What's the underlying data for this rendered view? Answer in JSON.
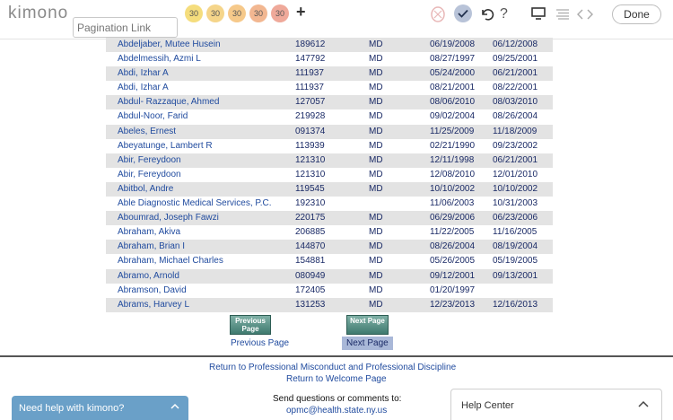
{
  "toolbar": {
    "logo": "kimono",
    "pagination_placeholder": "Pagination Link",
    "badges": [
      "30",
      "30",
      "30",
      "30",
      "30"
    ],
    "add_label": "+",
    "help_label": "?",
    "done_label": "Done"
  },
  "table": {
    "rows": [
      {
        "name": "Abdeljaber, Mutee Husein",
        "num": "189612",
        "deg": "MD",
        "d1": "06/19/2008",
        "d2": "06/12/2008"
      },
      {
        "name": "Abdelmessih, Azmi L",
        "num": "147792",
        "deg": "MD",
        "d1": "08/27/1997",
        "d2": "09/25/2001"
      },
      {
        "name": "Abdi, Izhar A",
        "num": "111937",
        "deg": "MD",
        "d1": "05/24/2000",
        "d2": "06/21/2001"
      },
      {
        "name": "Abdi, Izhar A",
        "num": "111937",
        "deg": "MD",
        "d1": "08/21/2001",
        "d2": "08/22/2001"
      },
      {
        "name": "Abdul- Razzaque, Ahmed",
        "num": "127057",
        "deg": "MD",
        "d1": "08/06/2010",
        "d2": "08/03/2010"
      },
      {
        "name": "Abdul-Noor, Farid",
        "num": "219928",
        "deg": "MD",
        "d1": "09/02/2004",
        "d2": "08/26/2004"
      },
      {
        "name": "Abeles, Ernest",
        "num": "091374",
        "deg": "MD",
        "d1": "11/25/2009",
        "d2": "11/18/2009"
      },
      {
        "name": "Abeyatunge, Lambert R",
        "num": "113939",
        "deg": "MD",
        "d1": "02/21/1990",
        "d2": "09/23/2002"
      },
      {
        "name": "Abir, Fereydoon",
        "num": "121310",
        "deg": "MD",
        "d1": "12/11/1998",
        "d2": "06/21/2001"
      },
      {
        "name": "Abir, Fereydoon",
        "num": "121310",
        "deg": "MD",
        "d1": "12/08/2010",
        "d2": "12/01/2010"
      },
      {
        "name": "Abitbol, Andre",
        "num": "119545",
        "deg": "MD",
        "d1": "10/10/2002",
        "d2": "10/10/2002"
      },
      {
        "name": "Able Diagnostic Medical Services, P.C.",
        "num": "192310",
        "deg": "",
        "d1": "11/06/2003",
        "d2": "10/31/2003"
      },
      {
        "name": "Aboumrad, Joseph Fawzi",
        "num": "220175",
        "deg": "MD",
        "d1": "06/29/2006",
        "d2": "06/23/2006"
      },
      {
        "name": "Abraham, Akiva",
        "num": "206885",
        "deg": "MD",
        "d1": "11/22/2005",
        "d2": "11/16/2005"
      },
      {
        "name": "Abraham, Brian I",
        "num": "144870",
        "deg": "MD",
        "d1": "08/26/2004",
        "d2": "08/19/2004"
      },
      {
        "name": "Abraham, Michael Charles",
        "num": "154881",
        "deg": "MD",
        "d1": "05/26/2005",
        "d2": "05/19/2005"
      },
      {
        "name": "Abramo, Arnold",
        "num": "080949",
        "deg": "MD",
        "d1": "09/12/2001",
        "d2": "09/13/2001"
      },
      {
        "name": "Abramson, David",
        "num": "172405",
        "deg": "MD",
        "d1": "01/20/1997",
        "d2": ""
      },
      {
        "name": "Abrams, Harvey L",
        "num": "131253",
        "deg": "MD",
        "d1": "12/23/2013",
        "d2": "12/16/2013"
      }
    ]
  },
  "pager": {
    "prev_img_text": "Previous Page",
    "next_img_text": "Next Page",
    "prev_link": "Previous Page",
    "next_link": "Next Page"
  },
  "footer": {
    "link1": "Return to Professional Misconduct and Professional Discipline",
    "link2": "Return to Welcome Page",
    "send": "Send questions or comments to:",
    "email": "opmc@health.state.ny.us"
  },
  "widgets": {
    "help_kimono": "Need help with kimono?",
    "help_center": "Help Center"
  },
  "colors": {
    "row_shade": "#e3e3e3",
    "link_blue": "#1f4a9e",
    "help_blue": "#6aa0c8"
  }
}
